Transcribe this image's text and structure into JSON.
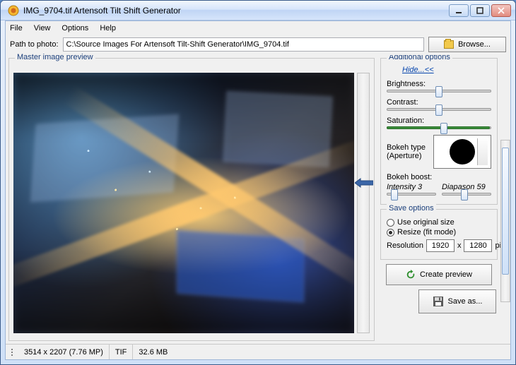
{
  "window": {
    "title": "IMG_9704.tif Artensoft Tilt Shift Generator"
  },
  "menu": {
    "file": "File",
    "view": "View",
    "options": "Options",
    "help": "Help"
  },
  "path": {
    "label": "Path to photo:",
    "value": "C:\\Source Images For Artensoft Tilt-Shift Generator\\IMG_9704.tif",
    "browse": "Browse..."
  },
  "preview": {
    "legend": "Master image preview"
  },
  "additional": {
    "legend": "Additional options",
    "hide": "Hide...<<",
    "brightness": {
      "label": "Brightness:",
      "pos": 50
    },
    "contrast": {
      "label": "Contrast:",
      "pos": 50
    },
    "saturation": {
      "label": "Saturation:",
      "pos": 55,
      "fill": 100
    },
    "bokeh_type_label": "Bokeh type (Aperture)",
    "bokeh_boost_label": "Bokeh boost:",
    "intensity": {
      "label": "Intensity 3",
      "pos": 15
    },
    "diapason": {
      "label": "Diapason 59",
      "pos": 45
    }
  },
  "save": {
    "legend": "Save options",
    "use_original": "Use original size",
    "resize_fit": "Resize (fit mode)",
    "resolution_label": "Resolution",
    "w": "1920",
    "h": "1280",
    "x": "x",
    "pixels": "pixels"
  },
  "actions": {
    "create_preview": "Create preview",
    "save_as": "Save as..."
  },
  "status": {
    "dims": "3514 x 2207 (7.76 MP)",
    "fmt": "TIF",
    "size": "32.6 MB"
  }
}
